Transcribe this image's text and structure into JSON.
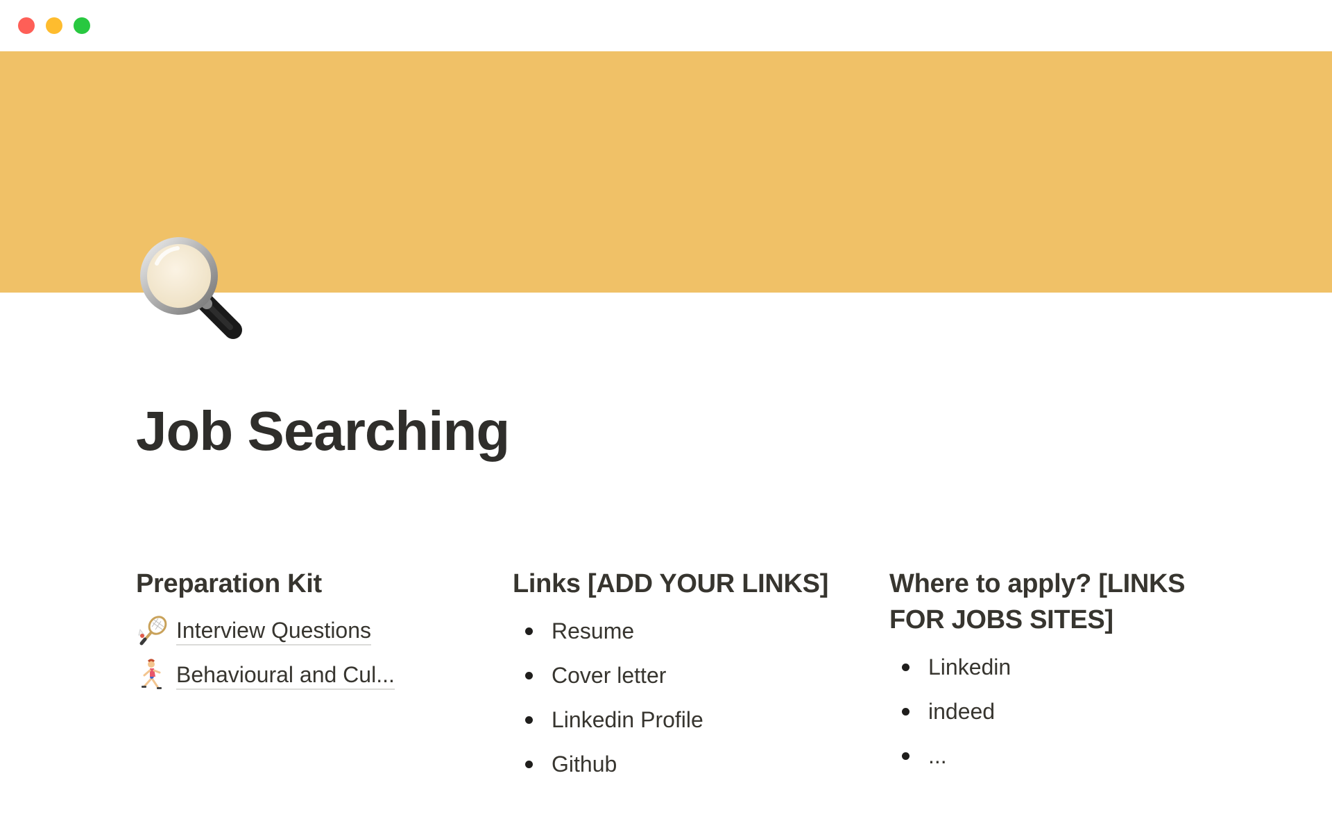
{
  "window": {
    "controls": [
      "close",
      "minimize",
      "maximize"
    ],
    "colors": {
      "close": "#fe5f57",
      "minimize": "#febc2e",
      "maximize": "#28c840"
    }
  },
  "cover": {
    "color": "#f0c167"
  },
  "page": {
    "icon": "magnifying-glass-icon",
    "title": "Job Searching"
  },
  "columns": {
    "preparation": {
      "heading": "Preparation Kit",
      "links": [
        {
          "icon": "badminton-racket-icon",
          "label": "Interview Questions"
        },
        {
          "icon": "runner-icon",
          "label": "Behavioural and Cul..."
        }
      ]
    },
    "links": {
      "heading": "Links [ADD YOUR LINKS]",
      "items": [
        "Resume",
        "Cover letter",
        "Linkedin Profile",
        "Github"
      ]
    },
    "apply": {
      "heading": "Where to apply? [LINKS FOR JOBS SITES]",
      "items": [
        "Linkedin",
        "indeed",
        "..."
      ]
    }
  }
}
